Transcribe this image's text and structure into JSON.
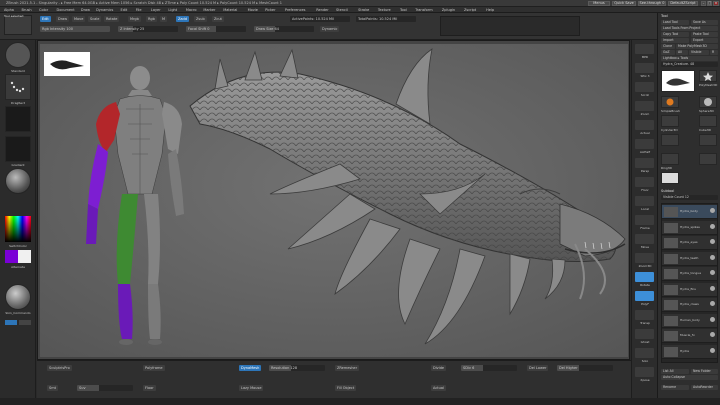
{
  "window": {
    "title": "ZBrush 2021.5.1 - Singularity - ▸ Free Mem 64.0GB ▸ Active Mem 1056 ▸ Scratch Disk 48 ▸ ZTime ▸ Poly Count 10.524 M ▸ PolyCount 10.524 M ▸ MeshCount 1",
    "right_buttons": [
      "Menus",
      "Quick Save",
      "See-through 0",
      "DefaultZScript"
    ]
  },
  "menubar": [
    "Alpha",
    "Brush",
    "Color",
    "Document",
    "Draw",
    "Dynamics",
    "Edit",
    "File",
    "Layer",
    "Light",
    "Macro",
    "Marker",
    "Material",
    "Movie",
    "Picker",
    "Preferences",
    "Render",
    "Stencil",
    "Stroke",
    "Texture",
    "Tool",
    "Transform",
    "Zplugin",
    "Zscript",
    "Help"
  ],
  "toolbar": {
    "mode_label": "Tool selected",
    "buttons": [
      "Edit",
      "Draw",
      "Move",
      "Scale",
      "Rotate"
    ],
    "sliders": [
      {
        "label": "Mrgb",
        "value": ""
      },
      {
        "label": "Rgb",
        "value": ""
      },
      {
        "label": "M",
        "value": ""
      },
      {
        "label": "Zadd",
        "value": ""
      },
      {
        "label": "Zsub",
        "value": ""
      },
      {
        "label": "Zcut",
        "value": ""
      }
    ],
    "rgb_intensity": "Rgb Intensity 100",
    "z_intensity": "Z Intensity 25",
    "focal_shift": "Focal Shift 0",
    "draw_size": "Draw Size 64",
    "dynamic": "Dynamic",
    "active_points": "ActivePoints: 10.524 Mil",
    "total_points": "TotalPoints: 10.524 Mil"
  },
  "left_shelf": {
    "labels": [
      "Standard",
      "DragRect",
      "Gradient",
      "SwitchColor",
      "Alternate"
    ],
    "bottom_labels": [
      "Skin_Commando",
      "Rgb"
    ]
  },
  "canvas": {
    "figure_creature": "hydra-creature",
    "figure_human": "anatomy-man"
  },
  "right_strip": {
    "labels": [
      "BPR",
      "SPix 3",
      "Scroll",
      "Zoom",
      "Actual",
      "AAHalf",
      "Persp",
      "Floor",
      "Local",
      "Frame",
      "Move",
      "Zoom3D",
      "Rotate",
      "PolyF",
      "Transp",
      "Ghost",
      "Solo",
      "Xpose"
    ]
  },
  "tool_palette": {
    "header": "Tool",
    "buttons": [
      "Load Tool",
      "Save As",
      "Load Tools From Project",
      "Copy Tool",
      "Paste Tool",
      "Import",
      "Export",
      "Clone",
      "Make PolyMesh3D",
      "GoZ",
      "All",
      "Visible",
      "R",
      "Lightbox ▸ Tools"
    ],
    "current": "Hydra_Creature. 48",
    "thumbs": [
      "Hydra_Creat",
      "PolyMesh3D",
      "SimpleBrush",
      "Sphere3D",
      "Cylinder3D",
      "Cube3D",
      "Hydra_Creature",
      "Skin_Commando",
      "Ring3D",
      "Hydra_Creature"
    ],
    "subtool_header": "Subtool",
    "visible_count": "Visible Count 12",
    "subtools": [
      "Hydra_body",
      "Hydra_spikes",
      "Hydra_eyes",
      "Hydra_teeth",
      "Hydra_tongue",
      "Hydra_fins",
      "Hydra_claws",
      "Human_body",
      "Muscle_fx",
      "Hydra"
    ],
    "footer": [
      "List All",
      "New Folder",
      "Auto Collapse",
      "Rename",
      "AutoReorder",
      "All Low",
      "All High",
      "Copy",
      "Paste",
      "Duplicate",
      "Append",
      "Insert",
      "Delete",
      "Del Other",
      "Del All",
      "Split",
      "Merge"
    ]
  },
  "bottom": {
    "groups": [
      {
        "title": "SculptrisPro",
        "value": ""
      },
      {
        "title": "Polyframe",
        "value": ""
      },
      {
        "title": "DynaMesh",
        "value": "Resolution 128"
      },
      {
        "title": "ZRemesher",
        "value": ""
      },
      {
        "title": "Divide",
        "value": "SDiv 6"
      },
      {
        "title": "Del Lower",
        "value": "Del Higher"
      },
      {
        "title": "Smt",
        "value": "Suv"
      },
      {
        "title": "Floor",
        "value": ""
      },
      {
        "title": "Lazy Mouse",
        "value": ""
      },
      {
        "title": "Fill Object",
        "value": ""
      },
      {
        "title": "Actual",
        "value": ""
      }
    ],
    "labels": [
      "Brush",
      "Alpha",
      "Texture",
      "Material",
      "Color",
      "PolyF",
      "Tx",
      "Ty",
      "Tz",
      "SDiv",
      "Dynamic",
      "ZRemesher"
    ]
  }
}
